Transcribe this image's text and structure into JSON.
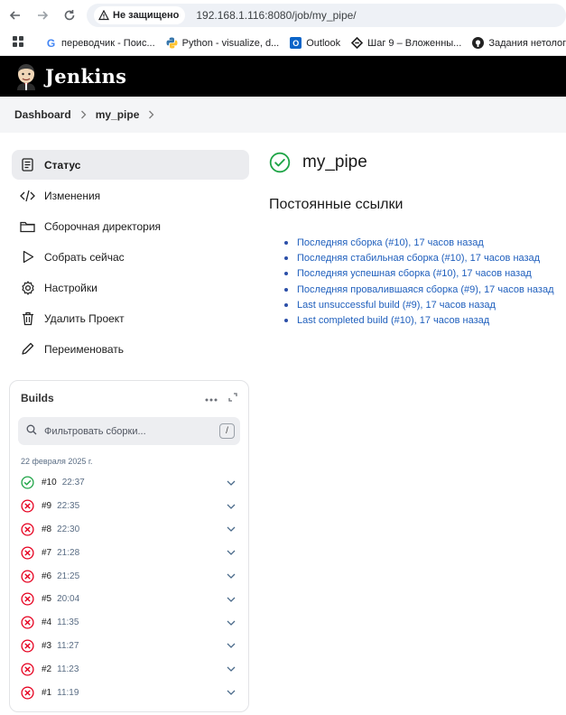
{
  "browser": {
    "security_label": "Не защищено",
    "url": "192.168.1.116:8080/job/my_pipe/",
    "bookmarks": [
      {
        "label": "переводчик - Поис...",
        "icon": "google-icon",
        "color": "#4285f4"
      },
      {
        "label": "Python - visualize, d...",
        "icon": "python-icon",
        "color": "#3776ab"
      },
      {
        "label": "Outlook",
        "icon": "outlook-icon",
        "color": "#0a64c8"
      },
      {
        "label": "Шаг 9 – Вложенны...",
        "icon": "stepik-icon",
        "color": "#222222"
      },
      {
        "label": "Задания нетология",
        "icon": "github-icon",
        "color": "#222222"
      }
    ]
  },
  "header": {
    "title": "Jenkins"
  },
  "breadcrumb": {
    "items": [
      "Dashboard",
      "my_pipe"
    ]
  },
  "sidebar": {
    "items": [
      {
        "label": "Статус",
        "icon": "status-icon",
        "active": true
      },
      {
        "label": "Изменения",
        "icon": "code-icon"
      },
      {
        "label": "Сборочная директория",
        "icon": "folder-icon"
      },
      {
        "label": "Собрать сейчас",
        "icon": "play-icon"
      },
      {
        "label": "Настройки",
        "icon": "gear-icon"
      },
      {
        "label": "Удалить Проект",
        "icon": "trash-icon"
      },
      {
        "label": "Переименовать",
        "icon": "pencil-icon"
      }
    ]
  },
  "builds": {
    "title": "Builds",
    "filter_placeholder": "Фильтровать сборки...",
    "shortcut": "/",
    "date": "22 февраля 2025 г.",
    "items": [
      {
        "number": "#10",
        "time": "22:37",
        "status": "success"
      },
      {
        "number": "#9",
        "time": "22:35",
        "status": "failed"
      },
      {
        "number": "#8",
        "time": "22:30",
        "status": "failed"
      },
      {
        "number": "#7",
        "time": "21:28",
        "status": "failed"
      },
      {
        "number": "#6",
        "time": "21:25",
        "status": "failed"
      },
      {
        "number": "#5",
        "time": "20:04",
        "status": "failed"
      },
      {
        "number": "#4",
        "time": "11:35",
        "status": "failed"
      },
      {
        "number": "#3",
        "time": "11:27",
        "status": "failed"
      },
      {
        "number": "#2",
        "time": "11:23",
        "status": "failed"
      },
      {
        "number": "#1",
        "time": "11:19",
        "status": "failed"
      }
    ]
  },
  "main": {
    "title": "my_pipe",
    "permalinks_title": "Постоянные ссылки",
    "permalinks": [
      "Последняя сборка (#10), 17 часов назад",
      "Последняя стабильная сборка (#10), 17 часов назад",
      "Последняя успешная сборка (#10), 17 часов назад",
      "Последняя провалившаяся сборка (#9), 17 часов назад",
      "Last unsuccessful build (#9), 17 часов назад",
      "Last completed build (#10), 17 часов назад"
    ]
  },
  "colors": {
    "success": "#1ea446",
    "failed": "#e6001f",
    "link": "#1f5fbd"
  }
}
